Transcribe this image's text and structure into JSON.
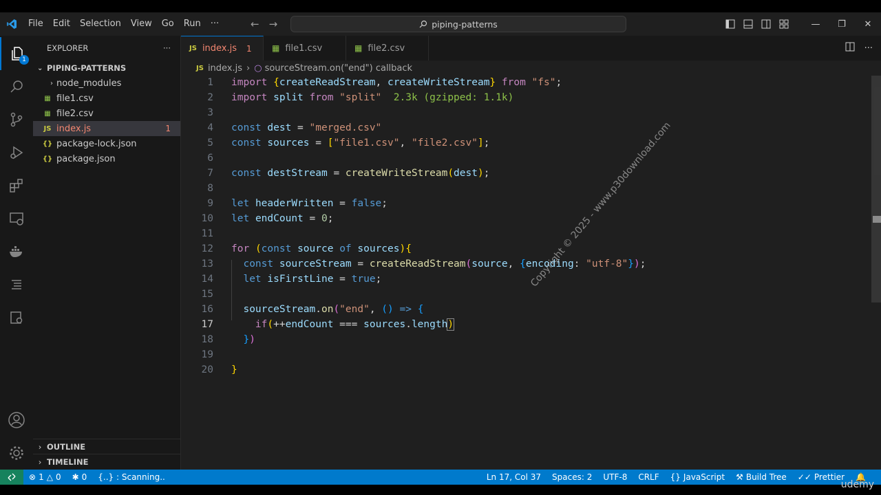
{
  "menu": [
    "File",
    "Edit",
    "Selection",
    "View",
    "Go",
    "Run",
    "···"
  ],
  "search": "piping-patterns",
  "explorer": {
    "title": "EXPLORER",
    "folder": "PIPING-PATTERNS",
    "files": [
      {
        "name": "node_modules",
        "kind": "folder"
      },
      {
        "name": "file1.csv",
        "kind": "csv"
      },
      {
        "name": "file2.csv",
        "kind": "csv"
      },
      {
        "name": "index.js",
        "kind": "js",
        "errors": "1"
      },
      {
        "name": "package-lock.json",
        "kind": "json"
      },
      {
        "name": "package.json",
        "kind": "json"
      }
    ],
    "outline": "OUTLINE",
    "timeline": "TIMELINE"
  },
  "tabs": [
    {
      "label": "index.js",
      "errors": "1",
      "modified": true
    },
    {
      "label": "file1.csv"
    },
    {
      "label": "file2.csv"
    }
  ],
  "breadcrumb": {
    "file": "index.js",
    "symbol": "sourceStream.on(\"end\") callback"
  },
  "activity_badge": "1",
  "line_numbers": [
    "1",
    "2",
    "3",
    "4",
    "5",
    "6",
    "7",
    "8",
    "9",
    "10",
    "11",
    "12",
    "13",
    "14",
    "15",
    "16",
    "17",
    "18",
    "19",
    "20"
  ],
  "watermark": "Copyright © 2025 - www.p30download.com",
  "status": {
    "scan": "{..} : Scanning..",
    "errors": "1",
    "warnings": "0",
    "ports": "0",
    "position": "Ln 17, Col 37",
    "spaces": "Spaces: 2",
    "encoding": "UTF-8",
    "eol": "CRLF",
    "language": "JavaScript",
    "buildtree": "Build Tree",
    "prettier": "Prettier"
  },
  "brand": "udemy"
}
